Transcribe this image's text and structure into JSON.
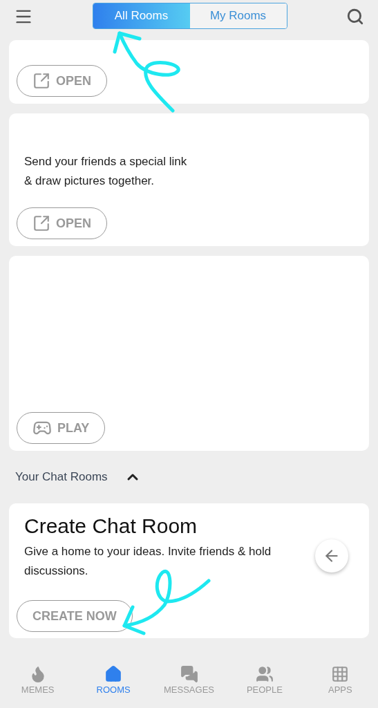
{
  "header": {
    "tabs": [
      {
        "label": "All Rooms",
        "selected": true
      },
      {
        "label": "My Rooms",
        "selected": false
      }
    ]
  },
  "cards": [
    {
      "kind": "clipped",
      "button": {
        "kind": "open",
        "label": "OPEN"
      }
    },
    {
      "kind": "text",
      "description": "Send your friends a special link\n& draw pictures together.",
      "button": {
        "kind": "open",
        "label": "OPEN"
      }
    },
    {
      "kind": "blank",
      "button": {
        "kind": "play",
        "label": "PLAY"
      }
    }
  ],
  "section": {
    "title": "Your Chat Rooms",
    "expanded": true
  },
  "create_card": {
    "title": "Create Chat Room",
    "description": "Give a home to your ideas. Invite friends & hold discussions.",
    "button": "CREATE NOW"
  },
  "nav": [
    {
      "kind": "memes",
      "label": "MEMES",
      "selected": false
    },
    {
      "kind": "rooms",
      "label": "ROOMS",
      "selected": true
    },
    {
      "kind": "messages",
      "label": "MESSAGES",
      "selected": false
    },
    {
      "kind": "people",
      "label": "PEOPLE",
      "selected": false
    },
    {
      "kind": "apps",
      "label": "APPS",
      "selected": false
    }
  ]
}
